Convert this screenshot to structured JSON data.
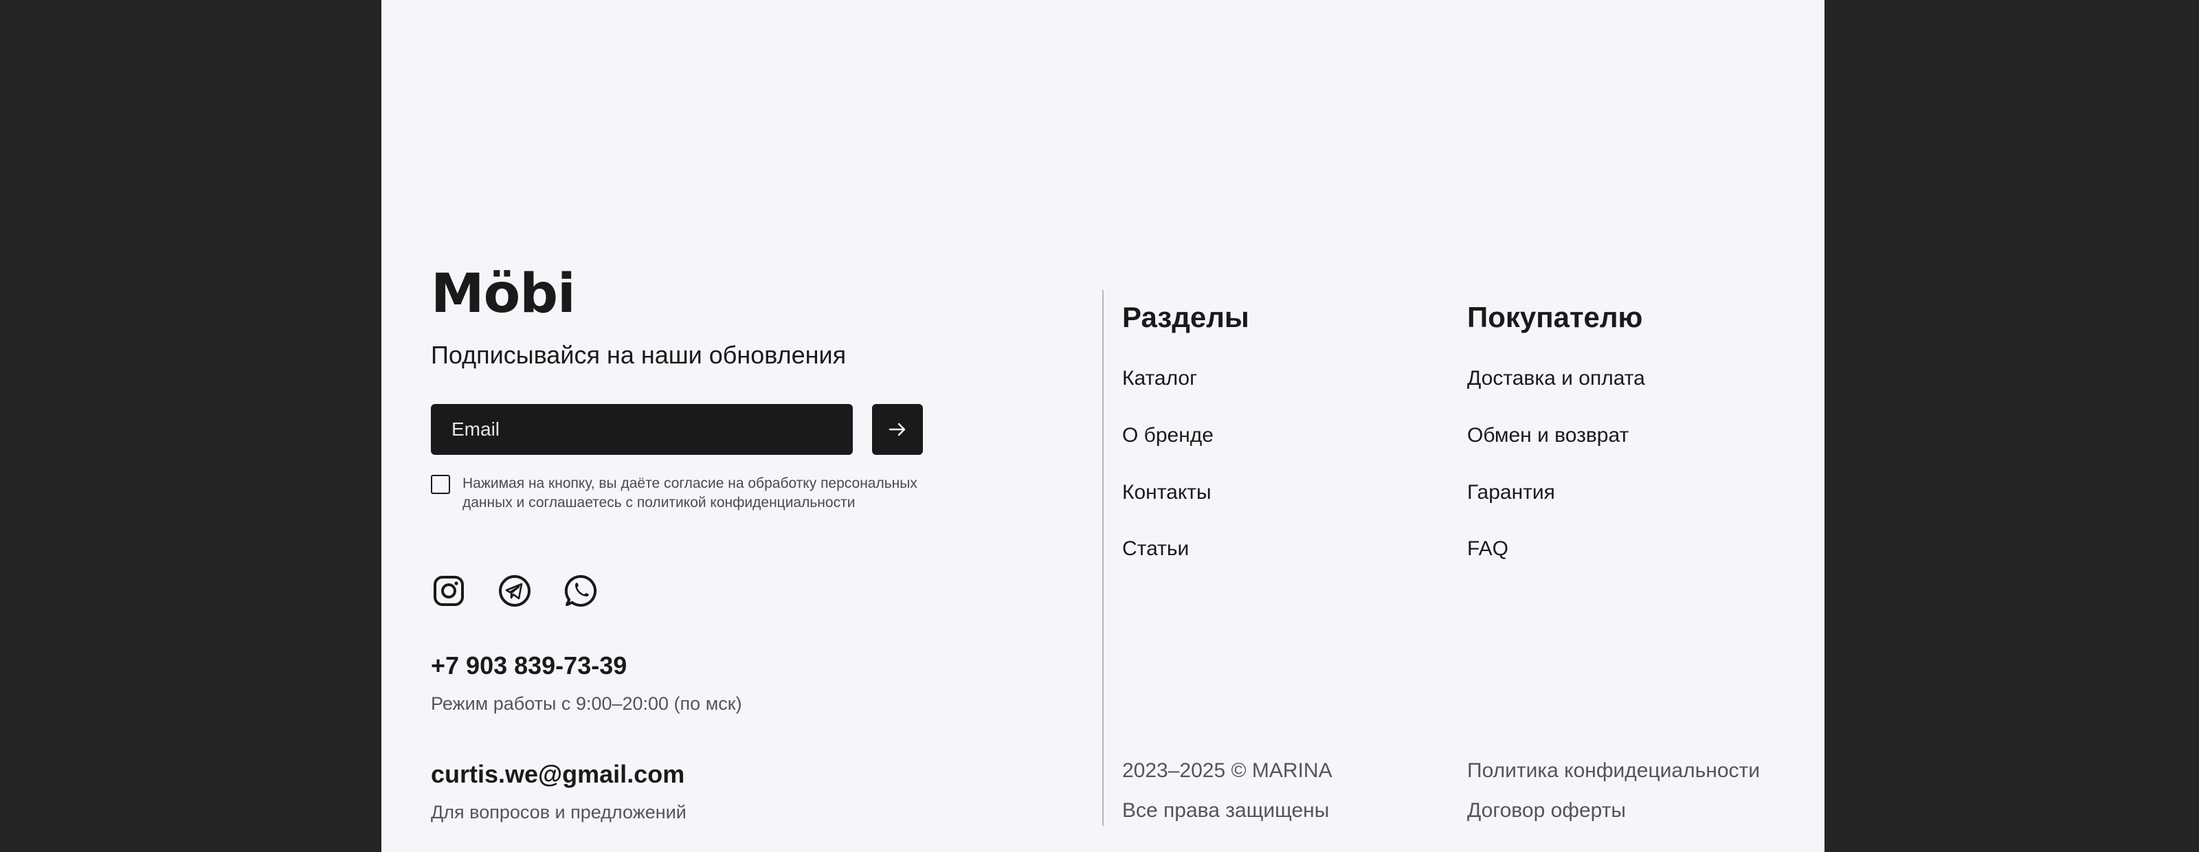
{
  "brand": {
    "logo": "Möbi"
  },
  "subscribe": {
    "title": "Подписывайся на наши обновления",
    "email_placeholder": "Email",
    "consent": "Нажимая на кнопку, вы даёте согласие на обработку персональных данных и соглашаетесь с политикой конфиденциальности"
  },
  "social": [
    "instagram-icon",
    "telegram-icon",
    "whatsapp-icon"
  ],
  "contacts": {
    "phone": "+7 903 839-73-39",
    "hours": "Режим работы с 9:00–20:00 (по мск)",
    "email": "curtis.we@gmail.com",
    "email_note": "Для вопросов и предложений"
  },
  "sections": {
    "title": "Разделы",
    "items": [
      "Каталог",
      "О бренде",
      "Контакты",
      "Статьи"
    ]
  },
  "buyer": {
    "title": "Покупателю",
    "items": [
      "Доставка и оплата",
      "Обмен и возврат",
      "Гарантия",
      "FAQ"
    ]
  },
  "bottom": {
    "copyright": "2023–2025 © MARINA",
    "rights": "Все права защищены",
    "privacy": "Политика конфидециальности",
    "offer": "Договор оферты"
  },
  "colors": {
    "page_bg": "#f5f6fa",
    "outer_bg": "#252525",
    "dark": "#1a1a1a",
    "muted_text": "#555555"
  }
}
